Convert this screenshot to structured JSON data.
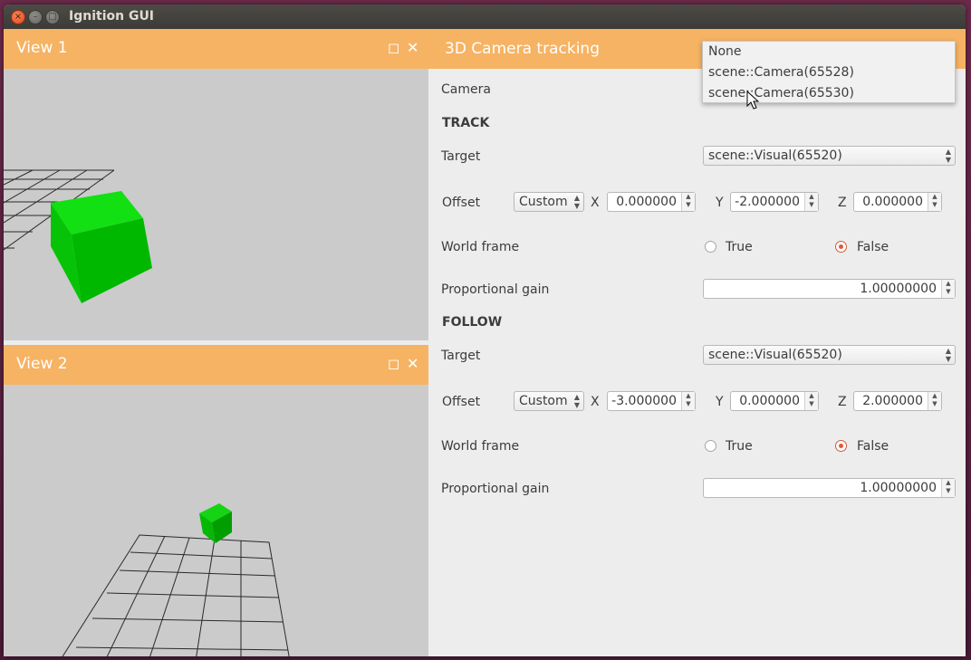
{
  "window": {
    "title": "Ignition GUI",
    "close_glyph": "×",
    "min_glyph": "–",
    "max_glyph": "□"
  },
  "view1": {
    "title": "View 1",
    "maximize_glyph": "◻",
    "close_glyph": "✕"
  },
  "view2": {
    "title": "View 2",
    "maximize_glyph": "◻",
    "close_glyph": "✕"
  },
  "panel": {
    "title": "3D Camera tracking",
    "camera_label": "Camera",
    "dropdown_options": [
      "None",
      "scene::Camera(65528)",
      "scene::Camera(65530)"
    ],
    "track": {
      "heading": "TRACK",
      "target_label": "Target",
      "target_value": "scene::Visual(65520)",
      "offset_label": "Offset",
      "offset_mode": "Custom",
      "x_label": "X",
      "x_value": "0.000000",
      "y_label": "Y",
      "y_value": "-2.000000",
      "z_label": "Z",
      "z_value": "0.000000",
      "world_frame_label": "World frame",
      "true_label": "True",
      "false_label": "False",
      "world_frame": false,
      "gain_label": "Proportional gain",
      "gain_value": "1.00000000"
    },
    "follow": {
      "heading": "FOLLOW",
      "target_label": "Target",
      "target_value": "scene::Visual(65520)",
      "offset_label": "Offset",
      "offset_mode": "Custom",
      "x_label": "X",
      "x_value": "-3.000000",
      "y_label": "Y",
      "y_value": "0.000000",
      "z_label": "Z",
      "z_value": "2.000000",
      "world_frame_label": "World frame",
      "true_label": "True",
      "false_label": "False",
      "world_frame": false,
      "gain_label": "Proportional gain",
      "gain_value": "1.00000000"
    }
  },
  "colors": {
    "header_orange": "#f6b363",
    "viewport_gray": "#cbcbcb",
    "cube_green": "#00cc00"
  }
}
